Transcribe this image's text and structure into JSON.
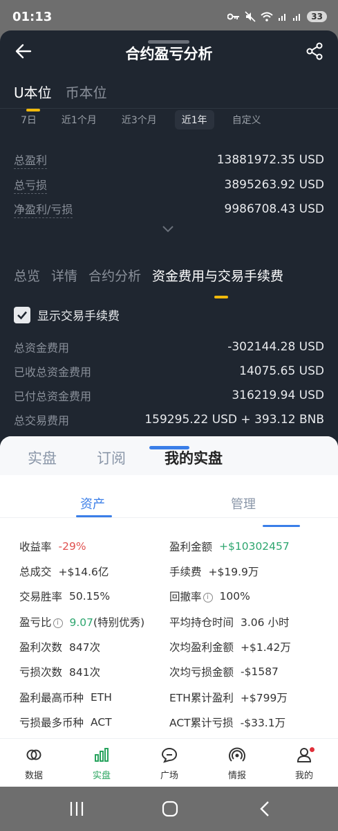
{
  "status_bar": {
    "time": "01:13",
    "battery": "33"
  },
  "header": {
    "title": "合约盈亏分析"
  },
  "unit_tabs": [
    "U本位",
    "币本位"
  ],
  "range_tabs": [
    "7日",
    "近1个月",
    "近3个月",
    "近1年",
    "自定义"
  ],
  "active_range": "近1年",
  "pnl": [
    {
      "label": "总盈利",
      "value": "13881972.35 USD"
    },
    {
      "label": "总亏损",
      "value": "3895263.92 USD"
    },
    {
      "label": "净盈利/亏损",
      "value": "9986708.43 USD"
    }
  ],
  "analysis_tabs": [
    "总览",
    "详情",
    "合约分析",
    "资金费用与交易手续费"
  ],
  "show_fee_checkbox": {
    "label": "显示交易手续费",
    "checked": true
  },
  "fees": [
    {
      "label": "总资金费用",
      "value": "-302144.28 USD"
    },
    {
      "label": "已收总资金费用",
      "value": "14075.65 USD"
    },
    {
      "label": "已付总资金费用",
      "value": "316219.94 USD"
    },
    {
      "label": "总交易费用",
      "value": "159295.22 USD + 393.12 BNB"
    }
  ],
  "sheet": {
    "tabs": [
      "实盘",
      "订阅",
      "我的实盘"
    ],
    "sub_tabs": [
      "资产",
      "管理"
    ],
    "stats_left": [
      {
        "label": "收益率",
        "value": "-29%"
      },
      {
        "label": "总成交",
        "value": "+$14.6亿"
      },
      {
        "label": "交易胜率",
        "value": "50.15%"
      },
      {
        "label": "盈亏比",
        "value": "9.07",
        "note": "(特别优秀)"
      },
      {
        "label": "盈利次数",
        "value": "847次"
      },
      {
        "label": "亏损次数",
        "value": "841次"
      },
      {
        "label": "盈利最高币种",
        "value": "ETH"
      },
      {
        "label": "亏损最多币种",
        "value": "ACT"
      }
    ],
    "stats_right": [
      {
        "label": "盈利金额",
        "value": "+$10302457"
      },
      {
        "label": "手续费",
        "value": "+$19.9万"
      },
      {
        "label": "回撤率",
        "value": "100%"
      },
      {
        "label": "平均持仓时间",
        "value": "3.06 小时"
      },
      {
        "label": "次均盈利金额",
        "value": "+$1.42万"
      },
      {
        "label": "次均亏损金额",
        "value": "-$1587"
      },
      {
        "label": "ETH累计盈利",
        "value": "+$799万"
      },
      {
        "label": "ACT累计亏损",
        "value": "-$33.1万"
      }
    ],
    "info_glyph": "i"
  },
  "bottom_nav": [
    "数据",
    "实盘",
    "广场",
    "情报",
    "我的"
  ],
  "colors": {
    "accent": "#f0b90b",
    "blue": "#3a7ee8",
    "green": "#2ea66f",
    "red": "#e0504f"
  }
}
